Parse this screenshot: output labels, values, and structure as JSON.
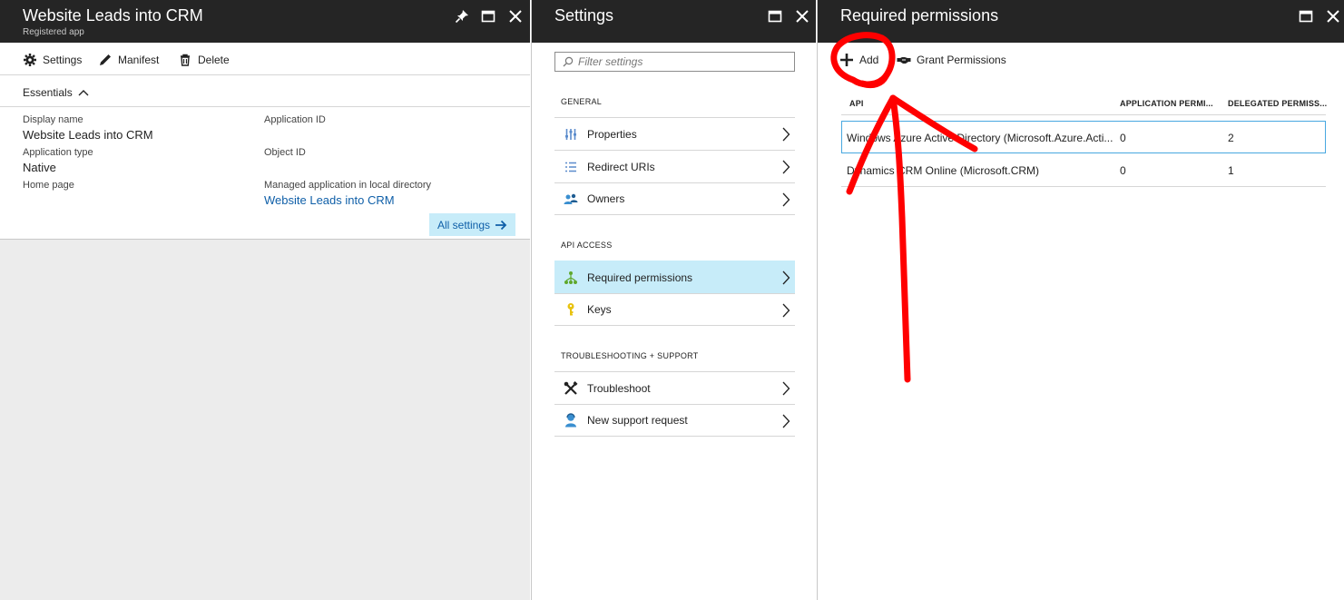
{
  "blade_settings_app": {
    "title": "Website Leads into CRM",
    "subtitle": "Registered app",
    "commands": {
      "settings": "Settings",
      "manifest": "Manifest",
      "delete": "Delete"
    },
    "essentials_label": "Essentials",
    "fields": {
      "display_name_label": "Display name",
      "display_name_value": "Website Leads into CRM",
      "application_type_label": "Application type",
      "application_type_value": "Native",
      "home_page_label": "Home page",
      "application_id_label": "Application ID",
      "object_id_label": "Object ID",
      "managed_app_label": "Managed application in local directory",
      "managed_app_link": "Website Leads into CRM"
    },
    "all_settings_label": "All settings"
  },
  "blade_settings": {
    "title": "Settings",
    "filter_placeholder": "Filter settings",
    "sections": {
      "general": "GENERAL",
      "api_access": "API ACCESS",
      "troubleshooting": "TROUBLESHOOTING + SUPPORT"
    },
    "items": {
      "properties": "Properties",
      "redirect_uris": "Redirect URIs",
      "owners": "Owners",
      "required_permissions": "Required permissions",
      "keys": "Keys",
      "troubleshoot": "Troubleshoot",
      "new_support_request": "New support request"
    },
    "active_item": "Required permissions"
  },
  "blade_permissions": {
    "title": "Required permissions",
    "commands": {
      "add": "Add",
      "grant": "Grant Permissions"
    },
    "columns": {
      "api": "API",
      "application": "APPLICATION PERMI...",
      "delegated": "DELEGATED PERMISS..."
    },
    "rows": [
      {
        "api": "Windows Azure Active Directory (Microsoft.Azure.Acti...",
        "application": "0",
        "delegated": "2"
      },
      {
        "api": "Dynamics CRM Online (Microsoft.CRM)",
        "application": "0",
        "delegated": "1"
      }
    ]
  },
  "colors": {
    "header_bg": "#252525",
    "accent_blue": "#0f5fa8",
    "selected_bg": "#c7ecf9",
    "annotation_red": "#ff0000"
  }
}
